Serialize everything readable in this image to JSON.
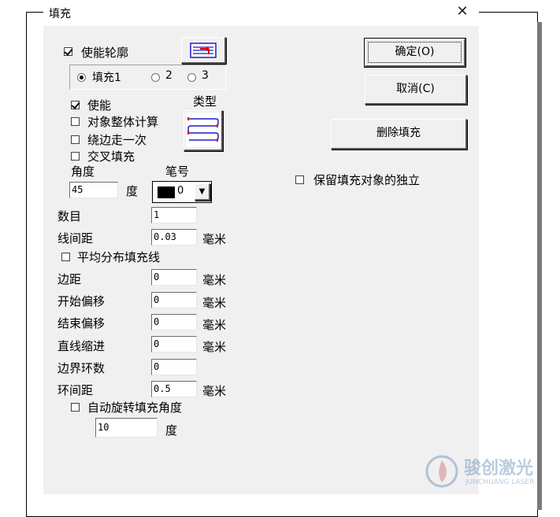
{
  "dialog": {
    "title": "填充",
    "close_glyph": "✕"
  },
  "outline_check": {
    "label": "使能轮廓",
    "checked": true
  },
  "fill_tabs": [
    {
      "label": "填充1",
      "selected": true
    },
    {
      "label": "2",
      "selected": false
    },
    {
      "label": "3",
      "selected": false
    }
  ],
  "enable": {
    "label": "使能",
    "checked": true
  },
  "type_label": "类型",
  "options": [
    {
      "label": "对象整体计算",
      "checked": false
    },
    {
      "label": "绕边走一次",
      "checked": false
    },
    {
      "label": "交叉填充",
      "checked": false
    }
  ],
  "angle": {
    "label": "角度",
    "value": "45",
    "unit": "度"
  },
  "pen": {
    "label": "笔号",
    "value": "0",
    "color": "#000000"
  },
  "count": {
    "label": "数目",
    "value": "1"
  },
  "line_spacing": {
    "label": "线间距",
    "value": "0.03",
    "unit": "毫米"
  },
  "even_distribution": {
    "label": "平均分布填充线",
    "checked": false
  },
  "margin": {
    "label": "边距",
    "value": "0",
    "unit": "毫米"
  },
  "start_offset": {
    "label": "开始偏移",
    "value": "0",
    "unit": "毫米"
  },
  "end_offset": {
    "label": "结束偏移",
    "value": "0",
    "unit": "毫米"
  },
  "line_indent": {
    "label": "直线缩进",
    "value": "0",
    "unit": "毫米"
  },
  "border_rings": {
    "label": "边界环数",
    "value": "0"
  },
  "ring_spacing": {
    "label": "环间距",
    "value": "0.5",
    "unit": "毫米"
  },
  "auto_rotate": {
    "label": "自动旋转填充角度",
    "checked": false,
    "value": "10",
    "unit": "度"
  },
  "buttons": {
    "ok": "确定(O)",
    "cancel": "取消(C)",
    "delete": "删除填充"
  },
  "keep_independent": {
    "label": "保留填充对象的独立",
    "checked": false
  },
  "watermark": {
    "name": "骏创激光",
    "sub": "JUNCHUANG LASER"
  },
  "colors": {
    "accent_red": "#e00000",
    "accent_blue": "#1c1cc8"
  }
}
